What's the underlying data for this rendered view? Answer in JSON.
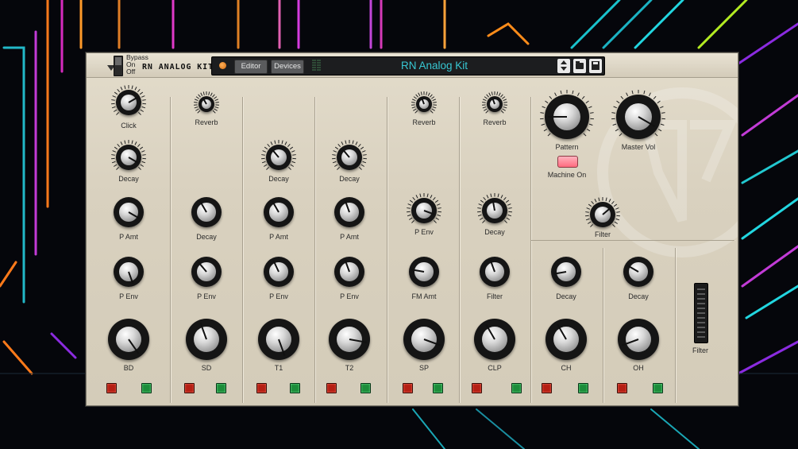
{
  "header": {
    "bypass_on": "Bypass",
    "on": "On",
    "off": "Off",
    "device_name": "RN ANALOG KIT",
    "editor_label": "Editor",
    "devices_label": "Devices",
    "patch_name": "RN Analog Kit"
  },
  "knobs": {
    "bd_click": "Click",
    "bd_decay": "Decay",
    "bd_pamt": "P Amt",
    "bd_penv": "P Env",
    "bd_main": "BD",
    "sd_reverb": "Reverb",
    "sd_decay": "Decay",
    "sd_penv": "P Env",
    "sd_main": "SD",
    "t1_decay": "Decay",
    "t1_pamt": "P Amt",
    "t1_penv": "P Env",
    "t1_main": "T1",
    "t2_decay": "Decay",
    "t2_pamt": "P Amt",
    "t2_penv": "P Env",
    "t2_main": "T2",
    "sp_reverb": "Reverb",
    "sp_penv": "P Env",
    "sp_fmamt": "FM Amt",
    "sp_main": "SP",
    "clp_reverb": "Reverb",
    "clp_decay": "Decay",
    "clp_filter": "Filter",
    "clp_main": "CLP",
    "pattern": "Pattern",
    "master_vol": "Master Vol",
    "machine_on": "Machine On",
    "hh_filter": "Filter",
    "ch_decay": "Decay",
    "ch_main": "CH",
    "oh_decay": "Decay",
    "oh_main": "OH",
    "fader_filter": "Filter"
  },
  "colors": {
    "panel": "#d9d1bf",
    "patch_name": "#37c7d3",
    "led_red": "#b51f14",
    "led_green": "#1c8c3a",
    "machine_on": "#ff6b7f"
  }
}
